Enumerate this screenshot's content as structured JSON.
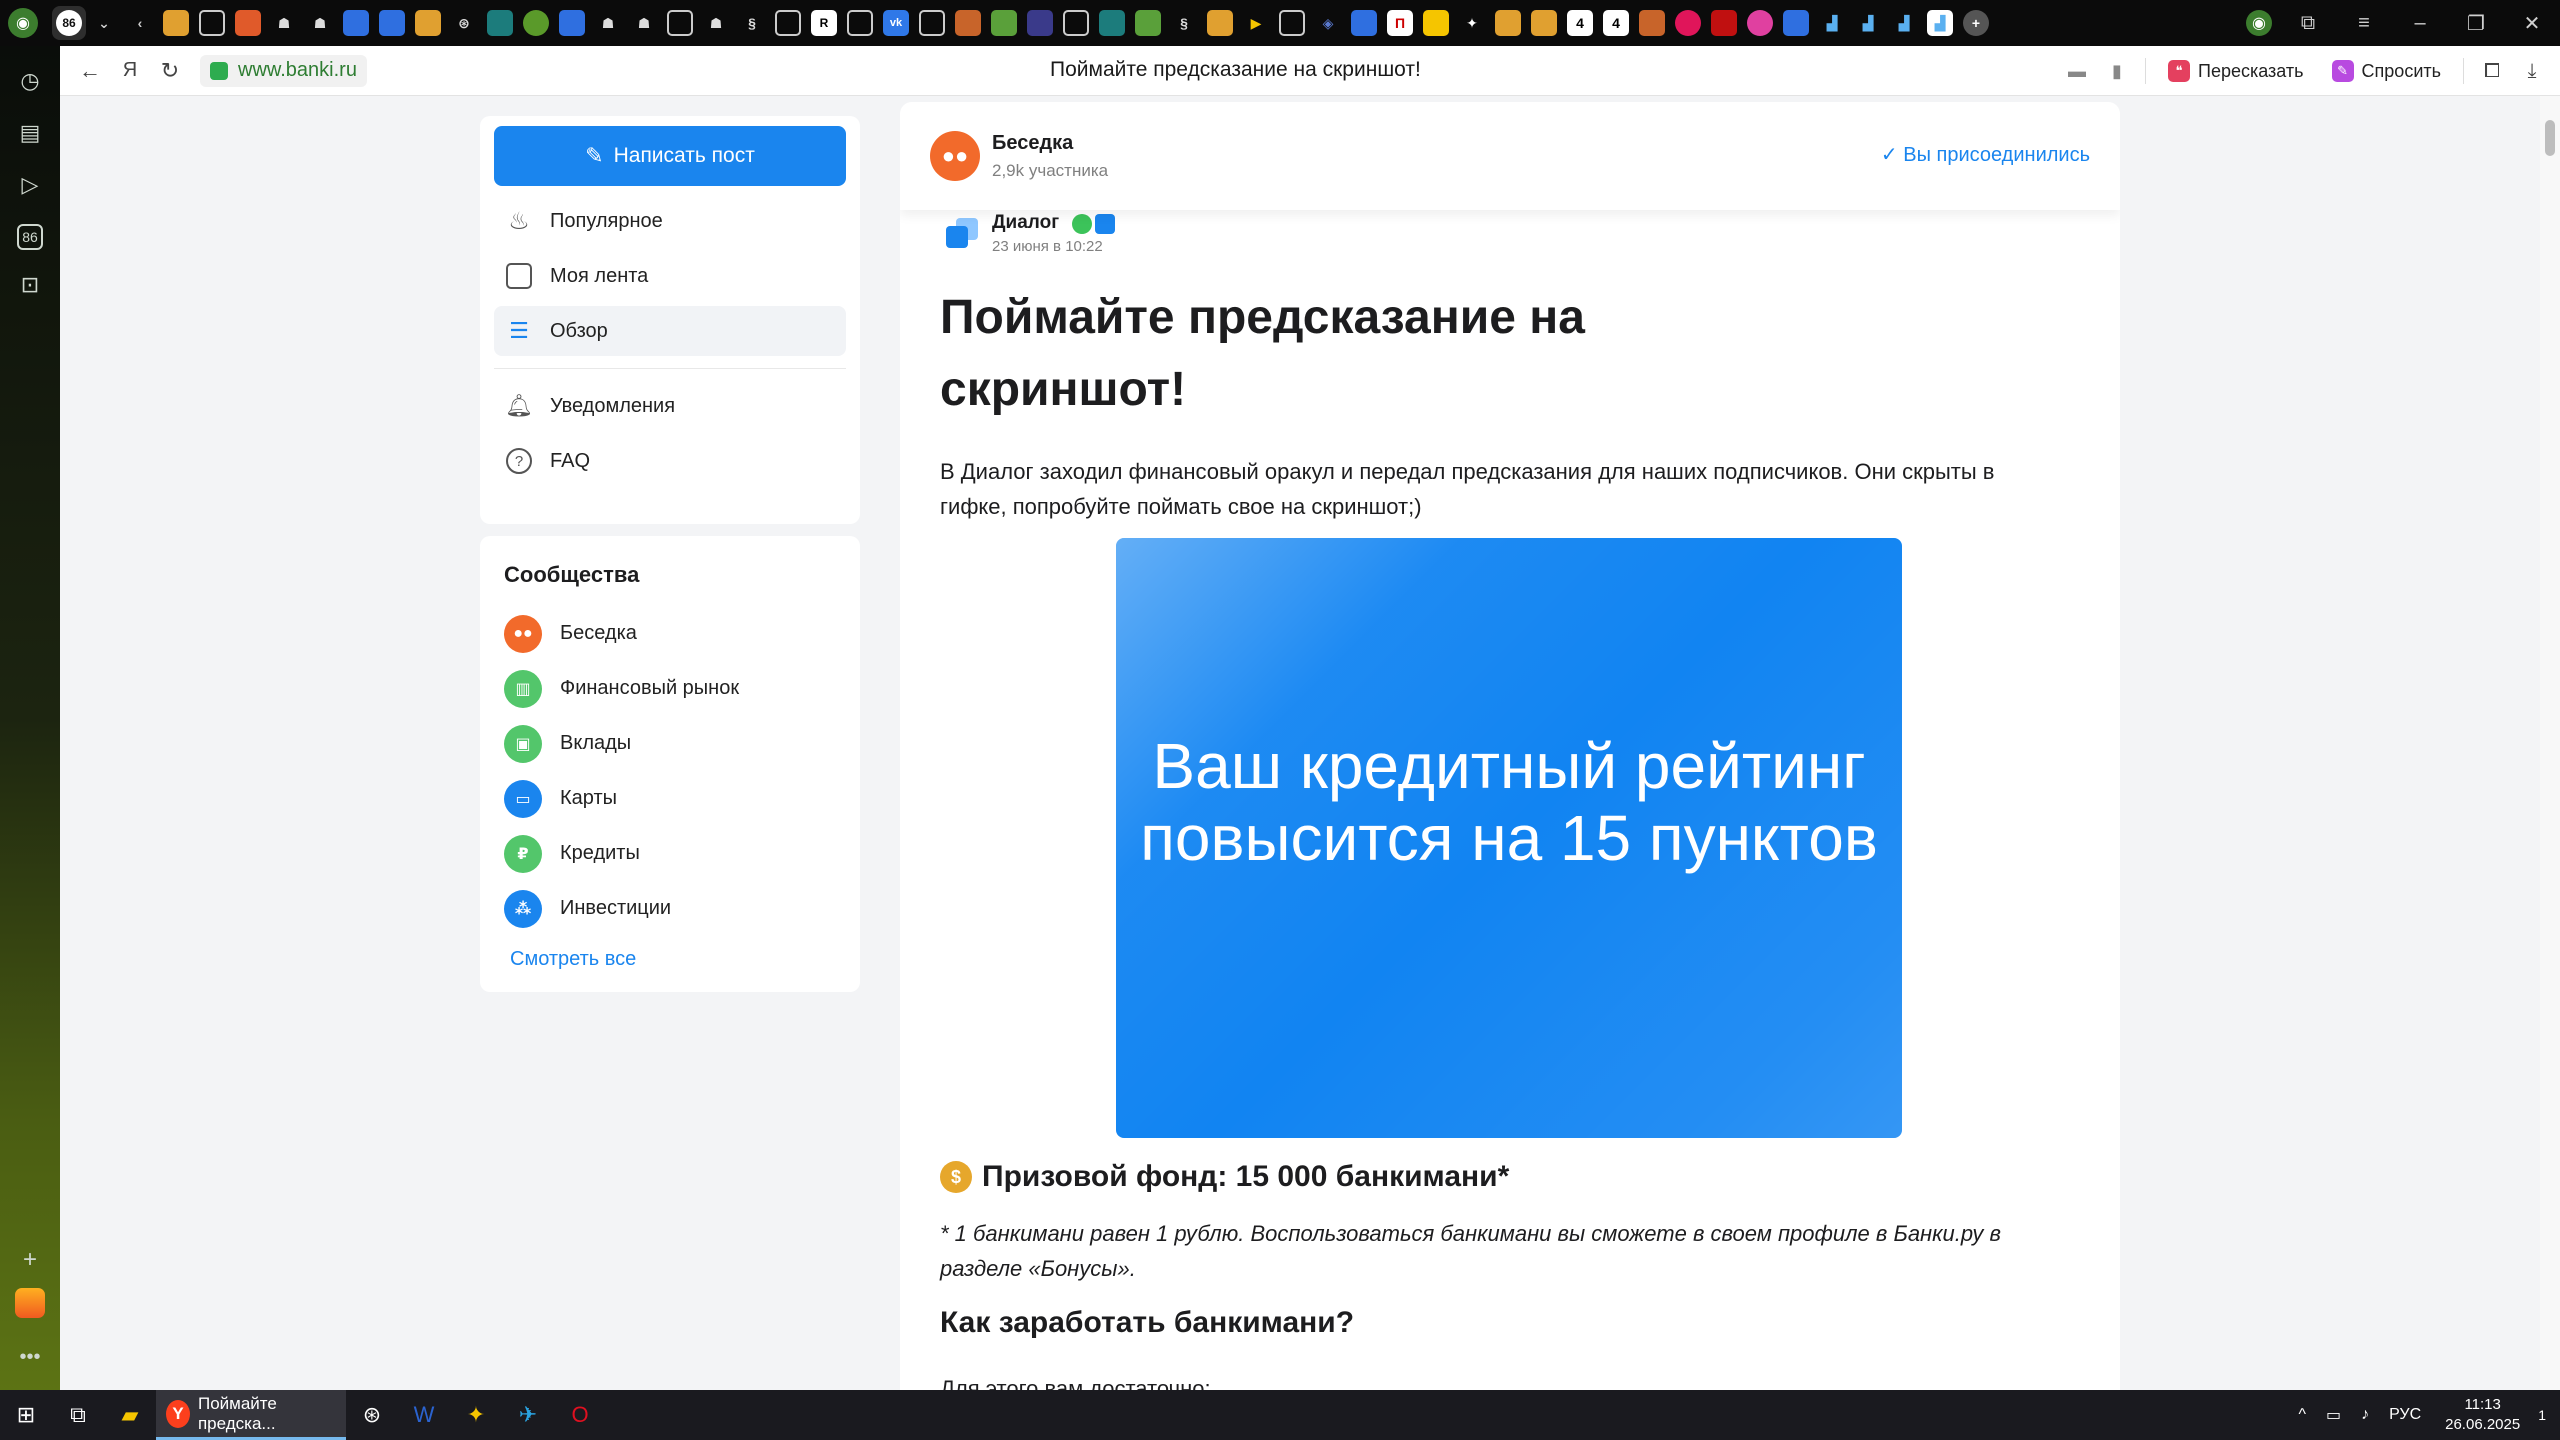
{
  "browser": {
    "tab_counter": "86",
    "url": "www.banki.ru",
    "page_title": "Поймайте предсказание на скриншот!",
    "actions": {
      "retell": "Пересказать",
      "ask": "Спросить"
    },
    "left_panel_badge": "86"
  },
  "nav": {
    "write_post": "Написать пост",
    "items": [
      {
        "label": "Популярное",
        "icon": "flame-icon"
      },
      {
        "label": "Моя лента",
        "icon": "feed-icon"
      },
      {
        "label": "Обзор",
        "icon": "overview-icon",
        "active": true
      },
      {
        "label": "Уведомления",
        "icon": "bell-icon"
      },
      {
        "label": "FAQ",
        "icon": "question-icon"
      }
    ]
  },
  "communities": {
    "title": "Сообщества",
    "items": [
      {
        "label": "Беседка",
        "color": "#f26a2b"
      },
      {
        "label": "Финансовый рынок",
        "color": "#53c66b"
      },
      {
        "label": "Вклады",
        "color": "#53c66b"
      },
      {
        "label": "Карты",
        "color": "#1a85ee"
      },
      {
        "label": "Кредиты",
        "color": "#53c66b"
      },
      {
        "label": "Инвестиции",
        "color": "#1a85ee"
      }
    ],
    "see_all": "Смотреть все"
  },
  "group": {
    "name": "Беседка",
    "members": "2,9k участника",
    "joined": "Вы присоединились"
  },
  "post": {
    "author": "Диалог",
    "date": "23 июня в 10:22",
    "title": "Поймайте предсказание на скриншот!",
    "lead": "В Диалог заходил финансовый оракул и передал предсказания для наших подписчиков. Они скрыты в гифке, попробуйте поймать свое на скриншот;)",
    "gif_text": "Ваш кредитный рейтинг повысится на 15 пунктов",
    "prize": "Призовой фонд: 15 000 банкимани*",
    "footnote": "* 1 банкимани равен 1 рублю. Воспользоваться банкимани вы сможете в своем профиле в Банки.ру в разделе «Бонусы».",
    "how_to": "Как заработать банкимани?",
    "cut_text": "Для этого вам достаточно:"
  },
  "taskbar": {
    "active_window": "Поймайте предска...",
    "lang": "РУС",
    "time": "11:13",
    "date": "26.06.2025",
    "notifications": "1"
  },
  "colors": {
    "accent": "#1a85ee",
    "url_green": "#2e7d32",
    "gif_bg": "#1184f2"
  }
}
